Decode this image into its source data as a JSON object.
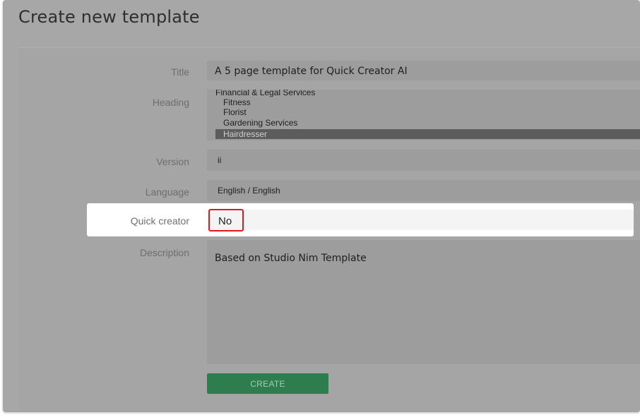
{
  "modal": {
    "title": "Create new template"
  },
  "form": {
    "title": {
      "label": "Title",
      "value": "A 5 page template for Quick Creator AI"
    },
    "heading": {
      "label": "Heading",
      "options": [
        {
          "text": "Financial & Legal Services"
        },
        {
          "text": "Fitness"
        },
        {
          "text": "Florist"
        },
        {
          "text": "Gardening Services"
        },
        {
          "text": "Hairdresser"
        }
      ],
      "selected": "Hairdresser"
    },
    "version": {
      "label": "Version",
      "value": "ii"
    },
    "language": {
      "label": "Language",
      "value": "English / English"
    },
    "quick_creator": {
      "label": "Quick creator",
      "value": "No"
    },
    "description": {
      "label": "Description",
      "value": "Based on Studio Nim Template"
    },
    "create_label": "CREATE"
  },
  "colors": {
    "overlay_gray": "#a7a7a7",
    "create_button": "#2e7d4f",
    "highlight_border": "#e1191c",
    "selected_option": "#5c5c5c"
  }
}
